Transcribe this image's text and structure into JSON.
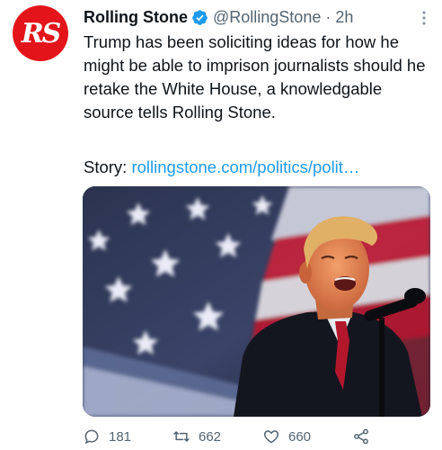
{
  "tweet": {
    "author": {
      "display_name": "Rolling Stone",
      "handle": "@RollingStone",
      "avatar_text": "RS",
      "verified": true
    },
    "separator": "·",
    "time": "2h",
    "text": "Trump has been soliciting ideas for how he might be able to imprison journalists should he retake the White House, a knowledgable source tells Rolling Stone.",
    "story_label": "Story:",
    "story_link": "rollingstone.com/politics/polit…",
    "media": {
      "description_icon": "photo"
    },
    "actions": {
      "replies": "181",
      "retweets": "662",
      "likes": "660"
    }
  },
  "colors": {
    "brand_red": "#e3151a",
    "link_blue": "#1d9bf0",
    "muted": "#536471",
    "text": "#0f1419"
  },
  "icons": [
    "verified-icon",
    "more-icon",
    "reply-icon",
    "retweet-icon",
    "like-icon",
    "share-icon"
  ]
}
